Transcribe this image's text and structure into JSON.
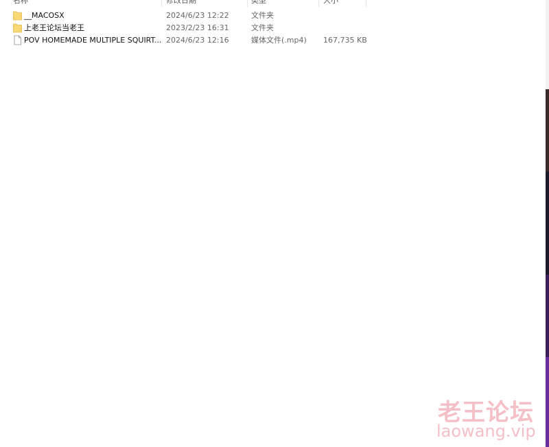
{
  "columns": {
    "name": "名称",
    "modified": "修改日期",
    "type": "类型",
    "size": "大小"
  },
  "files": [
    {
      "icon": "folder-icon",
      "name": "__MACOSX",
      "modified": "2024/6/23 12:22",
      "type": "文件夹",
      "size": ""
    },
    {
      "icon": "folder-icon",
      "name": "上老王论坛当老王",
      "modified": "2023/2/23 16:31",
      "type": "文件夹",
      "size": ""
    },
    {
      "icon": "file-icon",
      "name": "POV HOMEMADE MULTIPLE SQUIRT...",
      "modified": "2024/6/23 12:16",
      "type": "媒体文件(.mp4)",
      "size": "167,735 KB"
    }
  ],
  "watermark": {
    "title": "老王论坛",
    "url": "laowang.vip",
    "color": "#f4bfc6"
  },
  "colors": {
    "folder": "#f8d775",
    "folder_dark": "#e6b94a",
    "text_secondary": "#666666"
  }
}
